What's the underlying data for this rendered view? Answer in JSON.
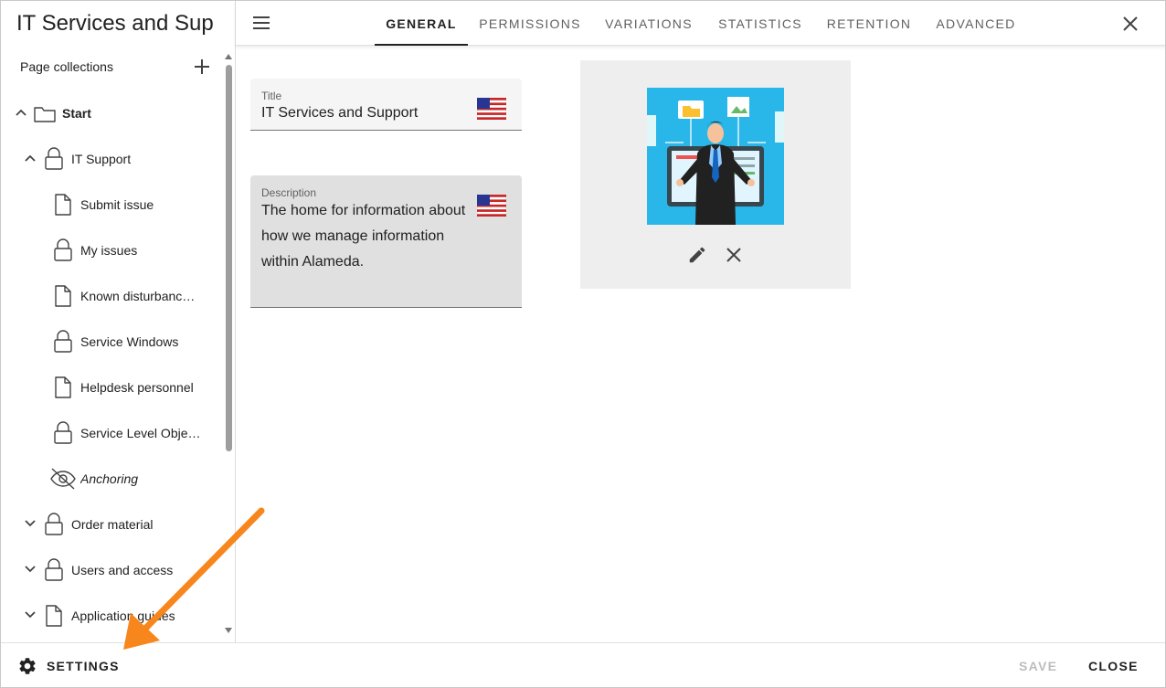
{
  "sidebar": {
    "title": "IT Services and Sup",
    "collections_label": "Page collections",
    "items": [
      {
        "label": "Start",
        "icon": "folder-icon",
        "chevron": "up"
      },
      {
        "label": "IT Support",
        "icon": "lock-icon",
        "chevron": "up"
      },
      {
        "label": "Submit issue",
        "icon": "page-icon"
      },
      {
        "label": "My issues",
        "icon": "lock-icon"
      },
      {
        "label": "Known disturbanc…",
        "icon": "page-icon"
      },
      {
        "label": "Service Windows",
        "icon": "lock-icon"
      },
      {
        "label": "Helpdesk personnel",
        "icon": "page-icon"
      },
      {
        "label": "Service Level Obje…",
        "icon": "lock-icon"
      },
      {
        "label": "Anchoring",
        "icon": "eye-off-icon"
      },
      {
        "label": "Order material",
        "icon": "lock-icon",
        "chevron": "down"
      },
      {
        "label": "Users and access",
        "icon": "lock-icon",
        "chevron": "down"
      },
      {
        "label": "Application guides",
        "icon": "page-icon",
        "chevron": "down"
      }
    ],
    "settings_label": "SETTINGS"
  },
  "header": {
    "tabs": [
      "GENERAL",
      "PERMISSIONS",
      "VARIATIONS",
      "STATISTICS",
      "RETENTION",
      "ADVANCED"
    ],
    "active_tab": "GENERAL"
  },
  "form": {
    "title_label": "Title",
    "title_value": "IT Services and Support",
    "description_label": "Description",
    "description_value": "The home for information about how we manage information within Alameda."
  },
  "footer": {
    "save_label": "SAVE",
    "close_label": "CLOSE"
  },
  "colors": {
    "accent_arrow": "#f7861c",
    "image_bg": "#29b6e8"
  }
}
